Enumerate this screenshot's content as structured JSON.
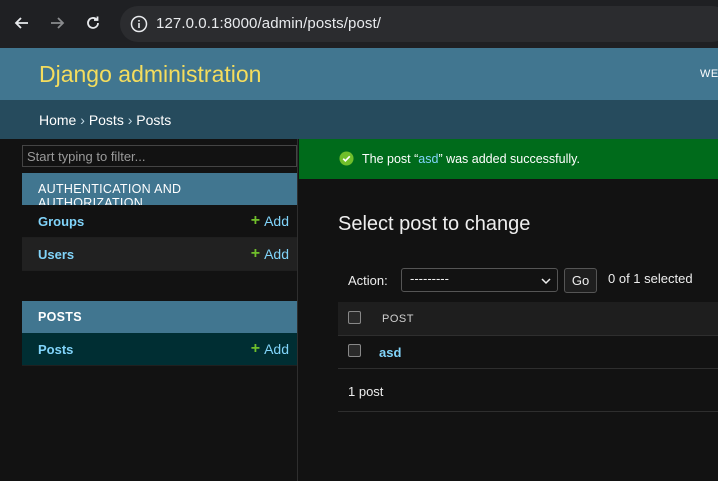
{
  "browser": {
    "url": "127.0.0.1:8000/admin/posts/post/"
  },
  "header": {
    "branding": "Django administration",
    "user_tools": "WE"
  },
  "breadcrumbs": {
    "home": "Home",
    "sep1": "›",
    "app": "Posts",
    "sep2": "›",
    "model": "Posts"
  },
  "sidebar": {
    "filter_placeholder": "Start typing to filter...",
    "modules": [
      {
        "caption": "AUTHENTICATION AND AUTHORIZATION",
        "rows": [
          {
            "label": "Groups",
            "add": "Add"
          },
          {
            "label": "Users",
            "add": "Add"
          }
        ]
      },
      {
        "caption": "POSTS",
        "rows": [
          {
            "label": "Posts",
            "add": "Add"
          }
        ]
      }
    ]
  },
  "message": {
    "prefix": "The post “",
    "object": "asd",
    "suffix": "” was added successfully."
  },
  "main": {
    "title": "Select post to change",
    "action_label": "Action:",
    "action_selected": "---------",
    "go": "Go",
    "selected_count": "0 of 1 selected",
    "column_header": "POST",
    "rows": [
      {
        "title": "asd"
      }
    ],
    "paginator": "1 post"
  },
  "colors": {
    "header_bg": "#417690",
    "branding": "#f5dd5d",
    "breadcrumbs_bg": "#264b5d",
    "success_bg": "#006b1b",
    "link": "#81d4fa",
    "add_plus": "#70bf2b"
  }
}
